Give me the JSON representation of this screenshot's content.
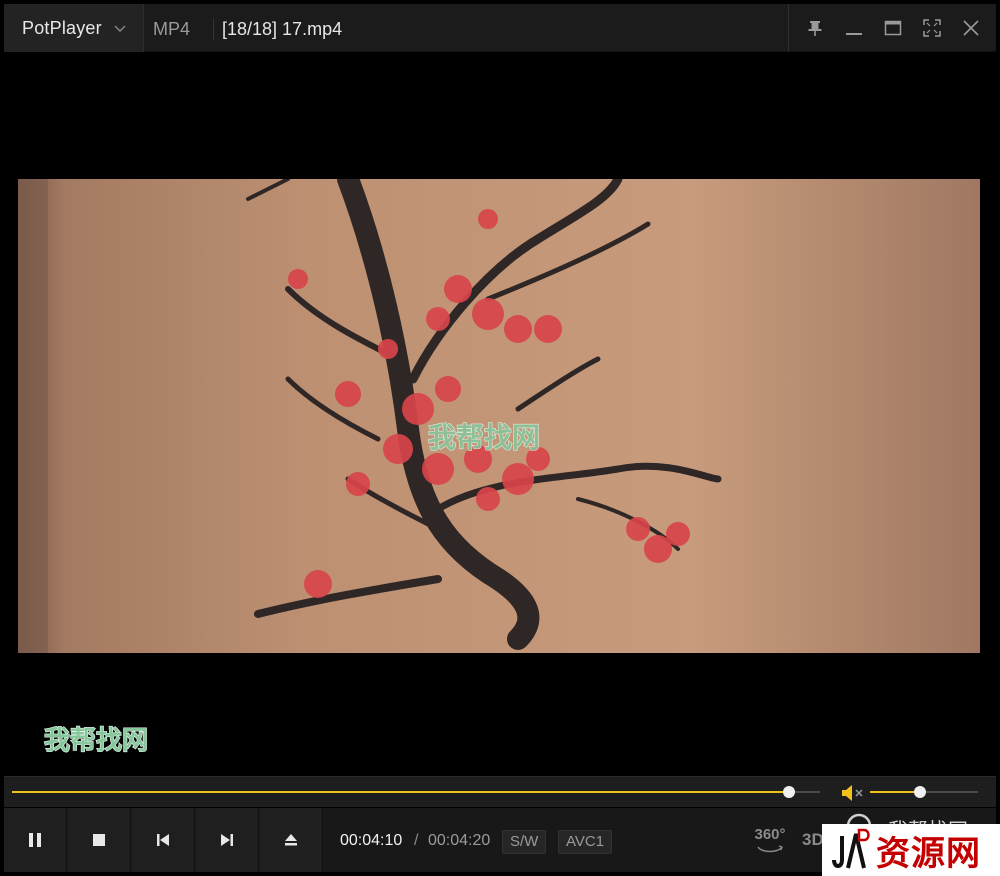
{
  "titlebar": {
    "app_name": "PotPlayer",
    "format": "MP4",
    "file_title": "[18/18] 17.mp4",
    "icons": [
      "chevron-down-icon",
      "pin-icon",
      "minimize-icon",
      "maximize-icon",
      "fullscreen-icon",
      "close-icon"
    ]
  },
  "video": {
    "watermark_center": "我帮找网",
    "watermark_corner": "我帮找网"
  },
  "playback": {
    "progress": 0.962,
    "volume": 0.46,
    "time_current": "00:04:10",
    "time_separator": "/",
    "time_total": "00:04:20",
    "decoder_tag": "S/W",
    "codec_tag": "AVC1",
    "btn_360": "360°",
    "btn_3d": "3D"
  },
  "controls": [
    "pause-icon",
    "stop-icon",
    "previous-icon",
    "next-icon",
    "eject-icon"
  ],
  "overlay": {
    "site_text": "我帮找网",
    "corner_logo_text": "资源网",
    "corner_logo_letters": "JA D"
  },
  "colors": {
    "accent": "#f2c21b",
    "titlebar_bg": "#1b1b1b",
    "logo_red": "#c40000"
  }
}
